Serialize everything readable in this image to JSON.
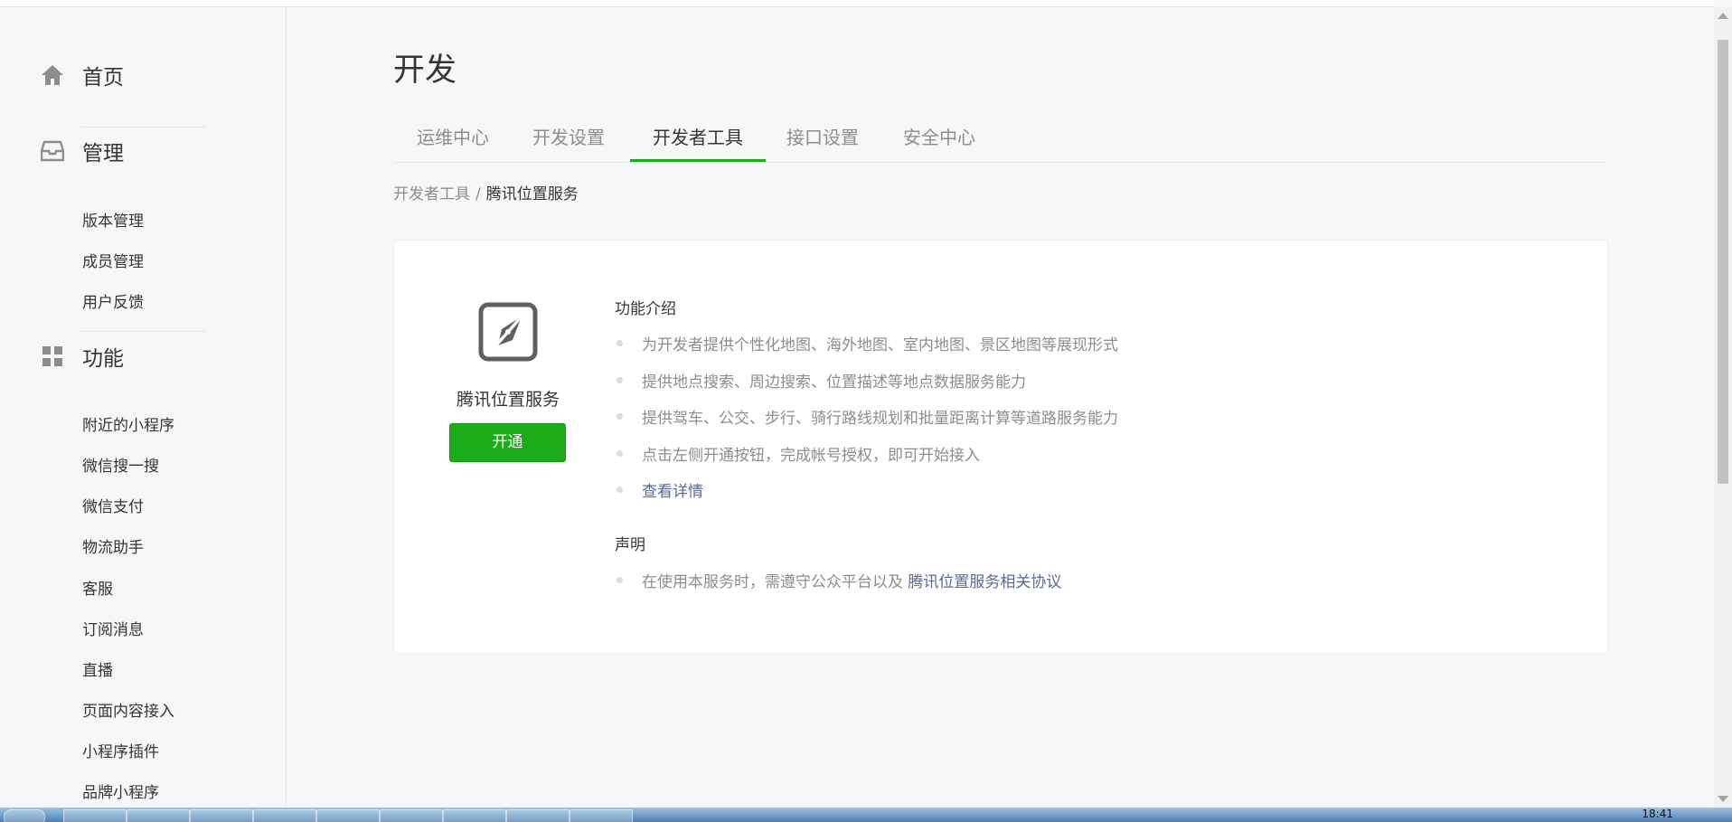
{
  "sidebar": {
    "home": {
      "label": "首页",
      "icon": "home-icon"
    },
    "manage": {
      "label": "管理",
      "icon": "inbox-icon",
      "items": [
        "版本管理",
        "成员管理",
        "用户反馈"
      ]
    },
    "features": {
      "label": "功能",
      "icon": "grid-icon",
      "items": [
        "附近的小程序",
        "微信搜一搜",
        "微信支付",
        "物流助手",
        "客服",
        "订阅消息",
        "直播",
        "页面内容接入",
        "小程序插件",
        "品牌小程序"
      ]
    }
  },
  "page": {
    "title": "开发"
  },
  "tabs": [
    {
      "label": "运维中心",
      "active": false
    },
    {
      "label": "开发设置",
      "active": false
    },
    {
      "label": "开发者工具",
      "active": true
    },
    {
      "label": "接口设置",
      "active": false
    },
    {
      "label": "安全中心",
      "active": false
    }
  ],
  "breadcrumb": {
    "parent": "开发者工具",
    "separator": "/",
    "current": "腾讯位置服务"
  },
  "service": {
    "name": "腾讯位置服务",
    "icon": "compass-icon",
    "open_button": "开通",
    "intro_heading": "功能介绍",
    "intro_items": [
      "为开发者提供个性化地图、海外地图、室内地图、景区地图等展现形式",
      "提供地点搜索、周边搜索、位置描述等地点数据服务能力",
      "提供驾车、公交、步行、骑行路线规划和批量距离计算等道路服务能力",
      "点击左侧开通按钮，完成帐号授权，即可开始接入"
    ],
    "details_link": "查看详情",
    "statement_heading": "声明",
    "statement_text": "在使用本服务时，需遵守公众平台以及",
    "statement_link": "腾讯位置服务相关协议"
  },
  "taskbar": {
    "clock": "18:41"
  },
  "colors": {
    "accent": "#1aad19",
    "link": "#576b95",
    "muted": "#8d8d8d",
    "text": "#353535"
  }
}
